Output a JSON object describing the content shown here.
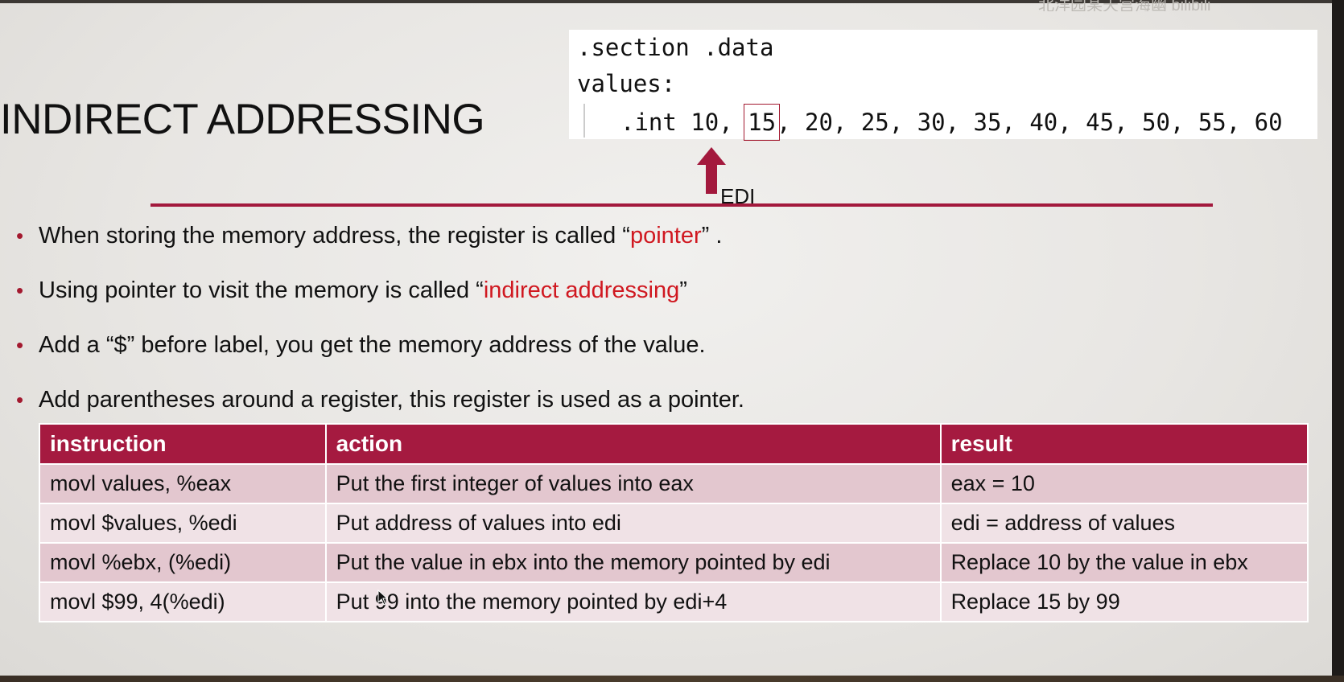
{
  "watermark": "北洋园某天宫海幽 bilibili",
  "title": "INDIRECT ADDRESSING",
  "code": {
    "line1": ".section .data",
    "line2": "values:",
    "line3_prefix": ".int 10, ",
    "line3_highlight": "15",
    "line3_suffix": ", 20, 25, 30, 35, 40, 45, 50, 55, 60"
  },
  "pointer_label": "EDI",
  "bullets": [
    {
      "pre": "When storing the memory address, the register is called “",
      "em": "pointer",
      "post": "” ."
    },
    {
      "pre": "Using pointer to visit the memory is called “",
      "em": "indirect addressing",
      "post": "”"
    },
    {
      "text": "Add a “$” before label, you get the memory address of the value."
    },
    {
      "text": "Add parentheses around a register, this register is used as a pointer."
    }
  ],
  "table": {
    "headers": [
      "instruction",
      "action",
      "result"
    ],
    "rows": [
      [
        "movl values, %eax",
        "Put the first integer of values into eax",
        "eax = 10"
      ],
      [
        "movl $values, %edi",
        "Put address of values into edi",
        "edi = address of values"
      ],
      [
        "movl %ebx, (%edi)",
        "Put the value in ebx into the memory pointed by edi",
        "Replace 10 by the value in ebx"
      ],
      [
        "movl $99, 4(%edi)",
        "Put 99 into the memory pointed by edi+4",
        "Replace 15 by 99"
      ]
    ]
  },
  "colors": {
    "accent": "#a3193d",
    "emphasis": "#d01820",
    "row_odd": "#e3c7cf",
    "row_even": "#f0e2e6"
  },
  "icons": {
    "pointer_arrow": "up-arrow-icon",
    "bullet": "bullet-dot-icon",
    "cursor": "mouse-cursor-icon"
  }
}
